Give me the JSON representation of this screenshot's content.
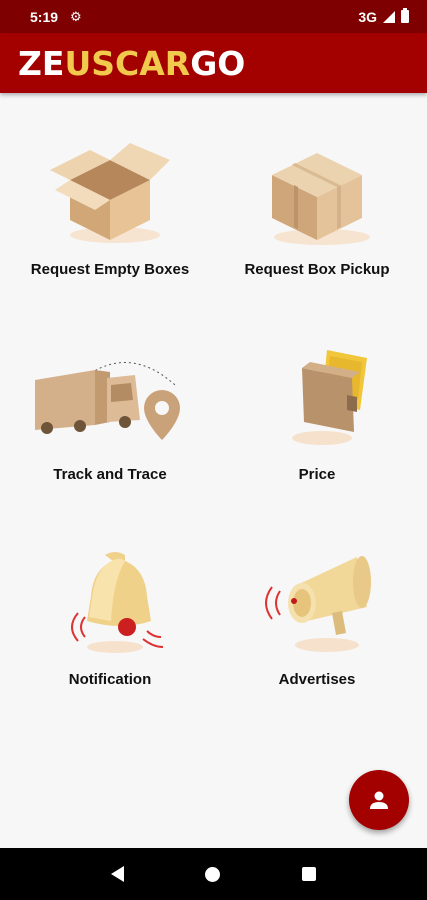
{
  "status_bar": {
    "time": "5:19",
    "network": "3G"
  },
  "app_bar": {
    "logo_part1": "ZE",
    "logo_part2": "USCAR",
    "logo_part3": "GO"
  },
  "tiles": [
    {
      "label": "Request Empty Boxes",
      "icon": "open-box-icon"
    },
    {
      "label": "Request Box Pickup",
      "icon": "closed-box-icon"
    },
    {
      "label": "Track and Trace",
      "icon": "truck-location-icon"
    },
    {
      "label": "Price",
      "icon": "wallet-icon"
    },
    {
      "label": "Notification",
      "icon": "bell-icon"
    },
    {
      "label": "Advertises",
      "icon": "megaphone-icon"
    }
  ],
  "fab": {
    "icon": "person-icon"
  },
  "nav": {
    "back": "back-icon",
    "home": "home-icon",
    "recents": "recents-icon"
  },
  "colors": {
    "primary": "#a30000",
    "status_bar": "#7f0000",
    "logo_accent": "#f1c94c"
  }
}
